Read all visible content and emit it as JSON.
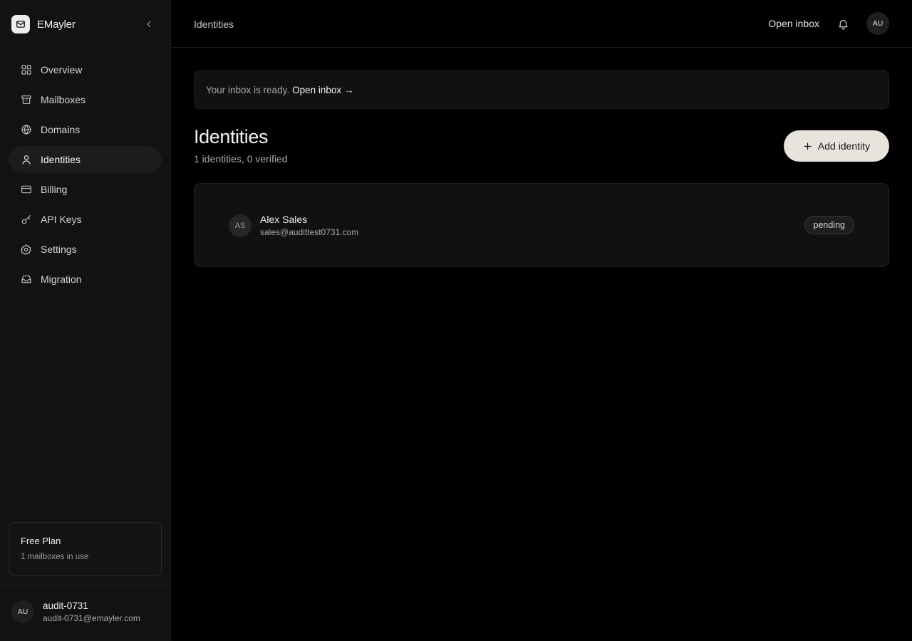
{
  "app": {
    "name": "EMayler",
    "logo_icon": "mail-icon"
  },
  "sidebar": {
    "collapse_icon": "chevron-left-icon",
    "items": [
      {
        "label": "Overview",
        "icon": "grid-icon",
        "active": false
      },
      {
        "label": "Mailboxes",
        "icon": "archive-box-icon",
        "active": false
      },
      {
        "label": "Domains",
        "icon": "globe-icon",
        "active": false
      },
      {
        "label": "Identities",
        "icon": "user-icon",
        "active": true
      },
      {
        "label": "Billing",
        "icon": "credit-card-icon",
        "active": false
      },
      {
        "label": "API Keys",
        "icon": "key-icon",
        "active": false
      },
      {
        "label": "Settings",
        "icon": "gear-icon",
        "active": false
      },
      {
        "label": "Migration",
        "icon": "inbox-icon",
        "active": false
      }
    ],
    "plan": {
      "title": "Free Plan",
      "subtitle": "1 mailboxes in use"
    },
    "user": {
      "initials": "AU",
      "name": "audit-0731",
      "email": "audit-0731@emayler.com"
    }
  },
  "header": {
    "breadcrumb": "Identities",
    "open_inbox_label": "Open inbox",
    "bell_icon": "bell-icon",
    "avatar_initials": "AU"
  },
  "banner": {
    "text": "Your inbox is ready.",
    "link_label": "Open inbox →"
  },
  "page": {
    "title": "Identities",
    "subtitle": "1 identities, 0 verified",
    "add_button_label": "Add identity"
  },
  "identities": [
    {
      "initials": "AS",
      "name": "Alex Sales",
      "email": "sales@audittest0731.com",
      "status": "pending"
    }
  ],
  "colors": {
    "background": "#000000",
    "sidebar": "#121212",
    "accent_button": "#e9e3de"
  }
}
